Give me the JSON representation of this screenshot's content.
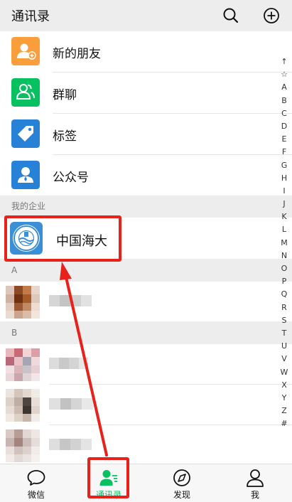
{
  "header": {
    "title": "通讯录"
  },
  "functions": [
    {
      "label": "新的朋友",
      "icon": "add-friend-icon",
      "color": "#fa9d3b"
    },
    {
      "label": "群聊",
      "icon": "group-chat-icon",
      "color": "#07c160"
    },
    {
      "label": "标签",
      "icon": "tag-icon",
      "color": "#2782d7"
    },
    {
      "label": "公众号",
      "icon": "official-account-icon",
      "color": "#2782d7"
    }
  ],
  "enterprise": {
    "section_title": "我的企业",
    "name": "中国海大",
    "icon": "ocean-university-logo"
  },
  "groups": [
    {
      "letter": "A"
    },
    {
      "letter": "B"
    }
  ],
  "index_letters": [
    "↑",
    "☆",
    "A",
    "B",
    "C",
    "D",
    "E",
    "F",
    "G",
    "H",
    "I",
    "J",
    "K",
    "L",
    "M",
    "N",
    "O",
    "P",
    "Q",
    "R",
    "S",
    "T",
    "U",
    "V",
    "W",
    "X",
    "Y",
    "Z",
    "#"
  ],
  "tabs": [
    {
      "label": "微信",
      "icon": "chat-bubble-icon"
    },
    {
      "label": "通讯录",
      "icon": "contacts-icon",
      "active": true
    },
    {
      "label": "发现",
      "icon": "compass-icon"
    },
    {
      "label": "我",
      "icon": "person-icon"
    }
  ],
  "colors": {
    "accent": "#07c160",
    "highlight": "#e8221b"
  }
}
